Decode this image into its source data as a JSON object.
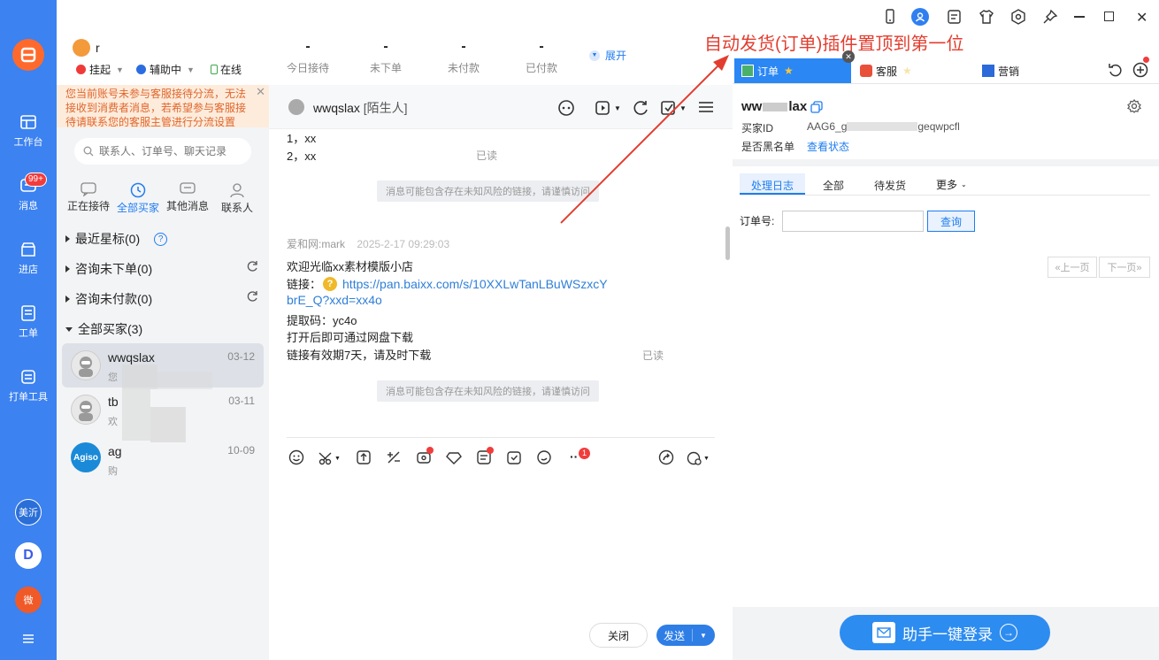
{
  "rail": {
    "items": [
      {
        "label": "工作台",
        "icon": "workbench-icon"
      },
      {
        "label": "消息",
        "icon": "message-icon",
        "badge": "99+"
      },
      {
        "label": "进店",
        "icon": "store-icon"
      },
      {
        "label": "工单",
        "icon": "ticket-icon"
      },
      {
        "label": "打单工具",
        "icon": "print-icon"
      }
    ],
    "apps": [
      "美沂",
      "D",
      "微"
    ]
  },
  "header": {
    "user_name": "r",
    "status_hangup": "挂起",
    "status_assist": "辅助中",
    "status_online": "在线",
    "stats": [
      {
        "value": "-",
        "label": "今日接待"
      },
      {
        "value": "-",
        "label": "未下单"
      },
      {
        "value": "-",
        "label": "未付款"
      },
      {
        "value": "-",
        "label": "已付款"
      }
    ],
    "expand": "展开"
  },
  "warning": "您当前账号未参与客服接待分流，无法接收到消费者消息，若希望参与客服接待请联系您的客服主管进行分流设置",
  "search": {
    "placeholder": "联系人、订单号、聊天记录"
  },
  "segments": [
    "正在接待",
    "全部买家",
    "其他消息",
    "联系人"
  ],
  "groups": [
    {
      "label": "最近星标(0)"
    },
    {
      "label": "咨询未下单(0)"
    },
    {
      "label": "咨询未付款(0)"
    },
    {
      "label": "全部买家(3)"
    }
  ],
  "conversations": [
    {
      "name": "wwqslax",
      "date": "03-12",
      "preview": "您"
    },
    {
      "name": "tb",
      "date": "03-11",
      "preview": "欢"
    },
    {
      "name": "ag",
      "date": "10-09",
      "preview": "购"
    }
  ],
  "chat": {
    "title": "wwqslax",
    "tag": "[陌生人]",
    "lines_top": [
      "1，xx",
      "2，xx"
    ],
    "read1": "已读",
    "notice": "消息可能包含存在未知风险的链接，请谨慎访问",
    "sender": "爱和网:mark",
    "time": "2025-2-17 09:29:03",
    "msg_intro": "欢迎光临xx素材模版小店",
    "link_label": "链接：",
    "link_line1": "https://pan.baixx.com/s/10XXLwTanLBuWSzxcY",
    "link_line2": "brE_Q?xxd=xx4o",
    "code": "提取码：yc4o",
    "open_tip": "打开后即可通过网盘下载",
    "expire": "链接有效期7天，请及时下载",
    "read2": "已读",
    "notice2": "消息可能包含存在未知风险的链接，请谨慎访问",
    "tool_badge": "1",
    "close_btn": "关闭",
    "send_btn": "发送"
  },
  "annotation": "自动发货(订单)插件置顶到第一位",
  "right": {
    "tabs": [
      "订单",
      "客服",
      "营销"
    ],
    "buyer_name": "ww",
    "buyer_name_end": "lax",
    "buyer_id_label": "买家ID",
    "buyer_id_start": "AAG6_g",
    "buyer_id_end": "geqwpcfl",
    "blacklist_label": "是否黑名单",
    "blacklist_link": "查看状态",
    "subtabs": [
      "处理日志",
      "全部",
      "待发货",
      "更多"
    ],
    "order_label": "订单号:",
    "query": "查询",
    "prev": "«上一页",
    "next": "下一页»",
    "login": "助手一键登录"
  },
  "colors": {
    "rail": "#3c82f0",
    "accent": "#1f7df0",
    "annotation": "#e23d2e",
    "tab_active": "#2b87f4"
  }
}
